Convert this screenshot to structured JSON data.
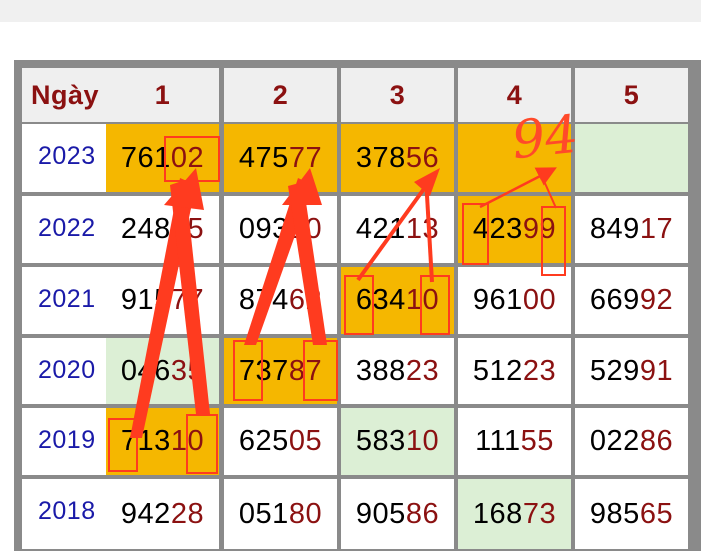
{
  "table": {
    "header": [
      "Ngày",
      "1",
      "2",
      "3",
      "4",
      "5"
    ],
    "rows": [
      {
        "year": "2023",
        "cells": [
          [
            "761",
            "02"
          ],
          [
            "475",
            "77"
          ],
          [
            "378",
            "56"
          ],
          [
            "",
            ""
          ],
          [
            "",
            ""
          ]
        ],
        "bg": [
          "ye",
          "ye",
          "ye",
          "ye",
          "gr"
        ]
      },
      {
        "year": "2022",
        "cells": [
          [
            "248",
            "15"
          ],
          [
            "093",
            "10"
          ],
          [
            "421",
            "13"
          ],
          [
            "423",
            "99"
          ],
          [
            "849",
            "17"
          ]
        ],
        "bg": [
          "wh",
          "wh",
          "wh",
          "ye",
          "wh"
        ]
      },
      {
        "year": "2021",
        "cells": [
          [
            "915",
            "77"
          ],
          [
            "874",
            "62"
          ],
          [
            "634",
            "10"
          ],
          [
            "961",
            "00"
          ],
          [
            "669",
            "92"
          ]
        ],
        "bg": [
          "wh",
          "wh",
          "ye",
          "wh",
          "wh"
        ]
      },
      {
        "year": "2020",
        "cells": [
          [
            "046",
            "35"
          ],
          [
            "737",
            "87"
          ],
          [
            "388",
            "23"
          ],
          [
            "512",
            "23"
          ],
          [
            "529",
            "91"
          ]
        ],
        "bg": [
          "gr",
          "ye",
          "wh",
          "wh",
          "wh"
        ]
      },
      {
        "year": "2019",
        "cells": [
          [
            "713",
            "10"
          ],
          [
            "625",
            "05"
          ],
          [
            "583",
            "10"
          ],
          [
            "111",
            "55"
          ],
          [
            "022",
            "86"
          ]
        ],
        "bg": [
          "ye",
          "wh",
          "gr",
          "wh",
          "wh"
        ]
      },
      {
        "year": "2018",
        "cells": [
          [
            "942",
            "28"
          ],
          [
            "051",
            "80"
          ],
          [
            "905",
            "86"
          ],
          [
            "168",
            "73"
          ],
          [
            "985",
            "65"
          ]
        ],
        "bg": [
          "wh",
          "wh",
          "wh",
          "gr",
          "wh"
        ]
      }
    ]
  },
  "annotation": {
    "note": "94",
    "color": "#ff3b1f"
  }
}
